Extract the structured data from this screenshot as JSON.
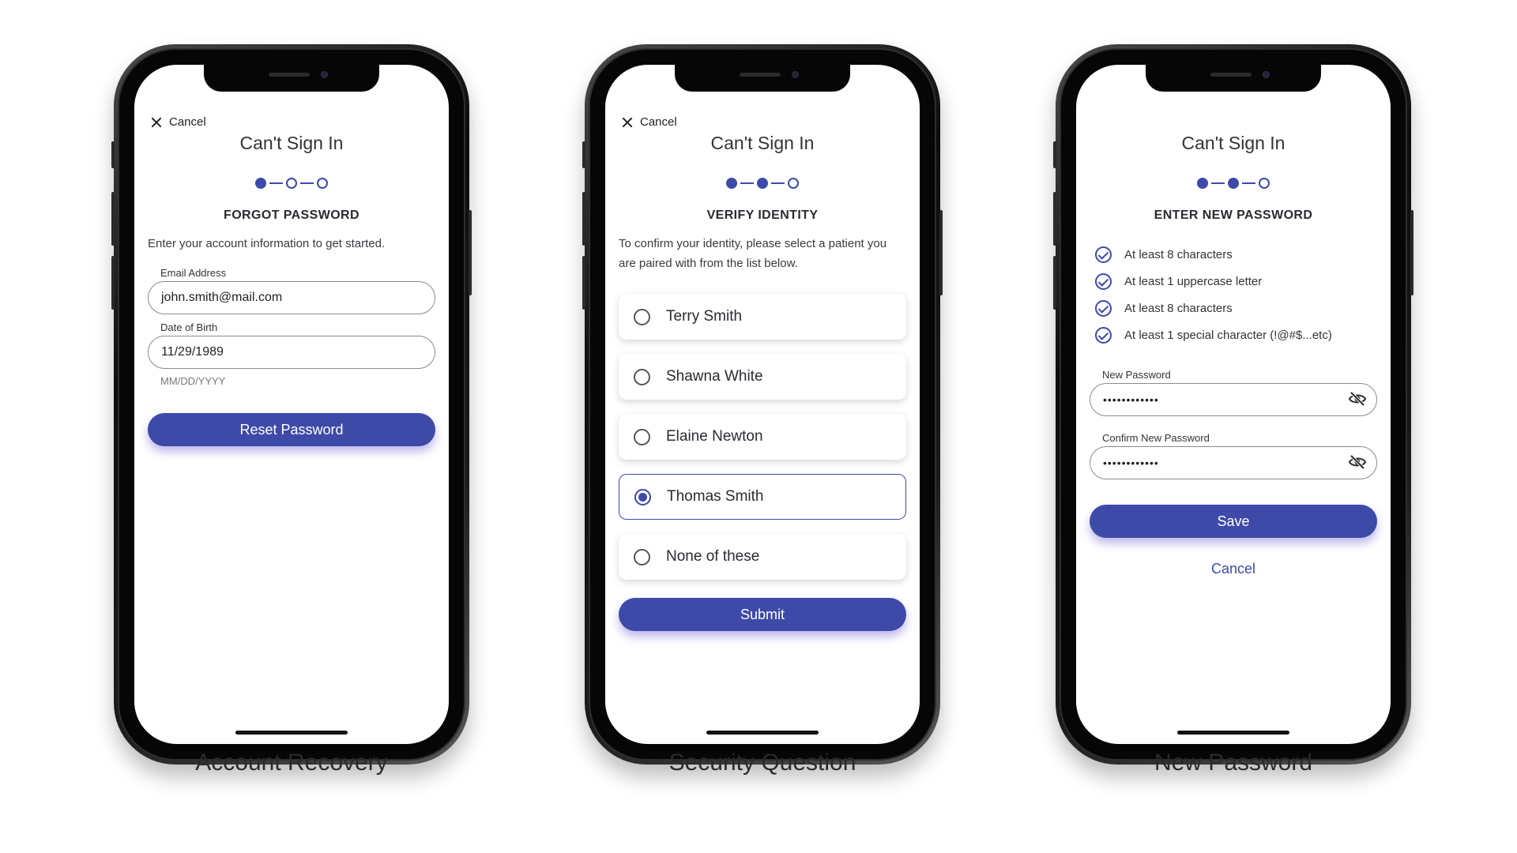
{
  "screens": [
    {
      "cancel_label": "Cancel",
      "title": "Can't Sign In",
      "section_title": "FORGOT PASSWORD",
      "intro": "Enter your account information to get started.",
      "email_label": "Email Address",
      "email_value": "john.smith@mail.com",
      "dob_label": "Date of Birth",
      "dob_value": "11/29/1989",
      "dob_hint": "MM/DD/YYYY",
      "button_label": "Reset Password",
      "step": 1
    },
    {
      "cancel_label": "Cancel",
      "title": "Can't Sign In",
      "section_title": "VERIFY IDENTITY",
      "intro": "To confirm your identity, please select a patient you are paired with from the list below.",
      "options": [
        {
          "label": "Terry Smith",
          "selected": false
        },
        {
          "label": "Shawna White",
          "selected": false
        },
        {
          "label": "Elaine Newton",
          "selected": false
        },
        {
          "label": "Thomas Smith",
          "selected": true
        },
        {
          "label": "None of these",
          "selected": false
        }
      ],
      "button_label": "Submit",
      "step": 2
    },
    {
      "title": "Can't Sign In",
      "section_title": "ENTER NEW PASSWORD",
      "rules": [
        "At least 8 characters",
        "At least 1 uppercase letter",
        "At least 8 characters",
        "At least 1 special character (!@#$...etc)"
      ],
      "new_password_label": "New Password",
      "new_password_value": "••••••••••••",
      "confirm_password_label": "Confirm New Password",
      "confirm_password_value": "••••••••••••",
      "button_label": "Save",
      "cancel_link": "Cancel",
      "step": 2
    }
  ],
  "captions": [
    "Account Recovery",
    "Security Question",
    "New Password"
  ],
  "colors": {
    "accent": "#3d4aa8",
    "text": "#2a2a33",
    "border": "#8a8a92"
  }
}
